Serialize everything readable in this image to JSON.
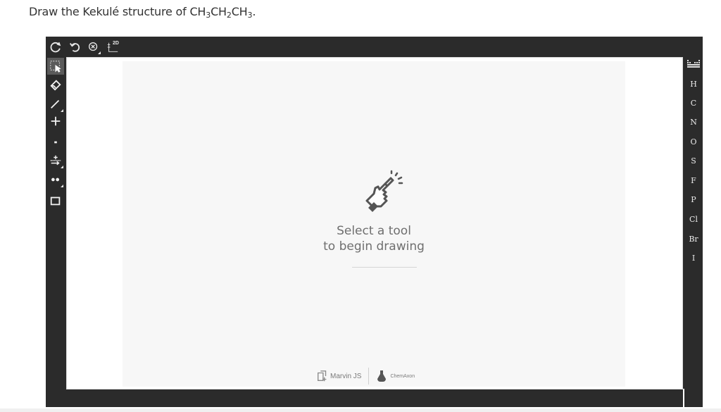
{
  "question": {
    "prefix": "Draw the Kekulé structure of CH",
    "sub1": "3",
    "mid1": "CH",
    "sub2": "2",
    "mid2": "CH",
    "sub3": "3",
    "suffix": "."
  },
  "top_toolbar": {
    "buttons": [
      {
        "name": "clear-icon"
      },
      {
        "name": "undo-icon"
      },
      {
        "name": "zoom-reset-icon"
      },
      {
        "name": "2d-clean-icon",
        "label": "2D"
      }
    ]
  },
  "left_toolbar": {
    "tools": [
      {
        "name": "select-tool-icon",
        "selected": true
      },
      {
        "name": "eraser-tool-icon"
      },
      {
        "name": "bond-tool-icon"
      },
      {
        "name": "increase-charge-icon"
      },
      {
        "name": "decrease-charge-icon"
      },
      {
        "name": "reaction-arrow-icon"
      },
      {
        "name": "lone-pair-icon"
      },
      {
        "name": "rectangle-shape-icon"
      }
    ]
  },
  "canvas": {
    "welcome_line1": "Select a tool",
    "welcome_line2": "to begin drawing",
    "marvin_label": "Marvin JS",
    "chemaxon_label": "ChemAxon"
  },
  "right_toolbar": {
    "elements": [
      "H",
      "C",
      "N",
      "O",
      "S",
      "F",
      "P",
      "Cl",
      "Br",
      "I"
    ]
  },
  "colors": {
    "toolbar_bg": "#2b2b2b",
    "canvas_bg": "#ffffff",
    "welcome_bg": "#f7f7f7",
    "text": "#333333"
  }
}
